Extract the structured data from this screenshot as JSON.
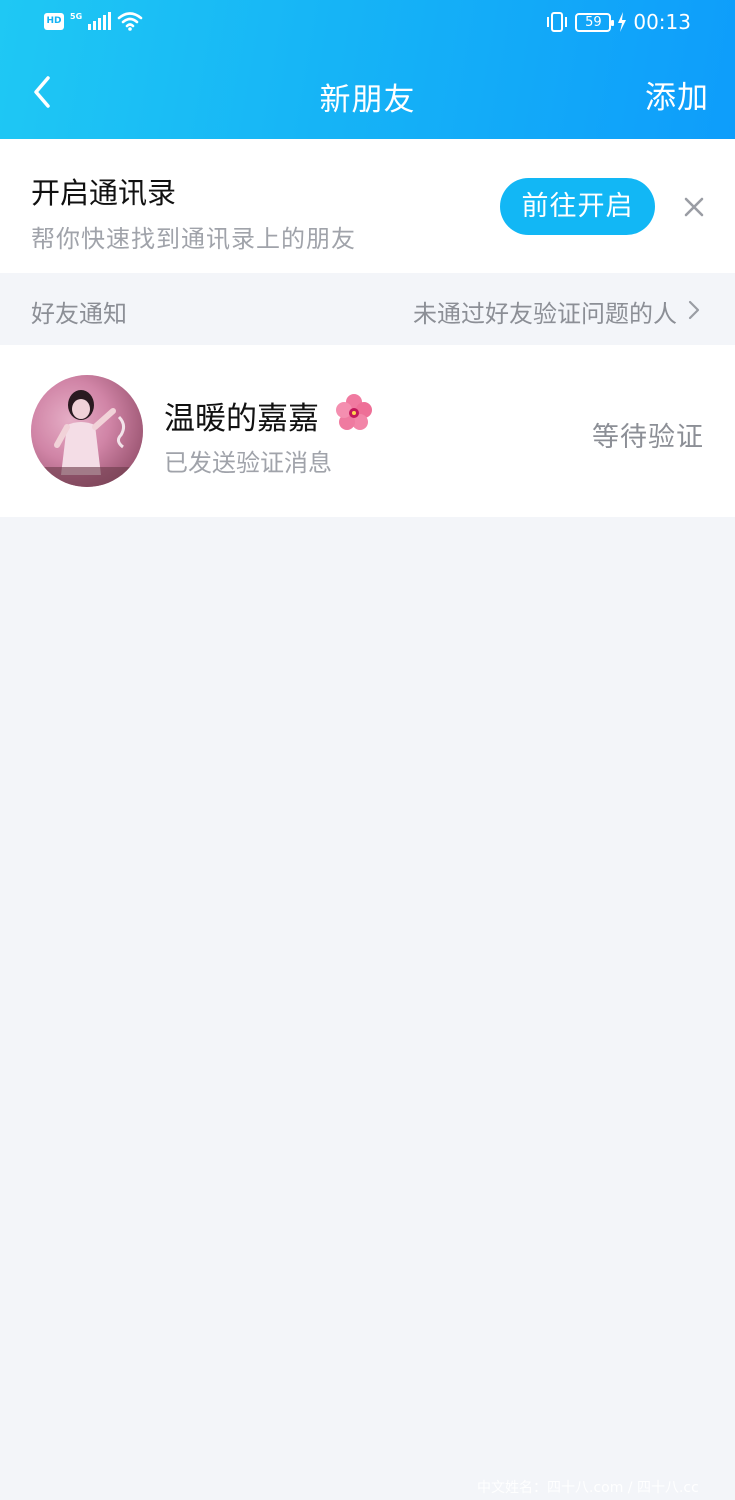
{
  "status_bar": {
    "hd_badge": "HD",
    "network": "5G",
    "battery_level": "59",
    "time": "00:13",
    "icons": [
      "hd-icon",
      "5g-signal-icon",
      "wifi-icon",
      "vibrate-icon",
      "battery-icon",
      "charging-icon"
    ]
  },
  "nav": {
    "title": "新朋友",
    "add_label": "添加",
    "back_icon": "chevron-left-icon"
  },
  "contacts_prompt": {
    "title": "开启通讯录",
    "subtitle": "帮你快速找到通讯录上的朋友",
    "action_label": "前往开启",
    "close_icon": "close-icon"
  },
  "section": {
    "title": "好友通知",
    "link_label": "未通过好友验证问题的人",
    "link_icon": "chevron-right-icon"
  },
  "friend_requests": [
    {
      "name": "温暖的嘉嘉",
      "name_icon": "hibiscus-flower-icon",
      "message": "已发送验证消息",
      "status": "等待验证"
    }
  ],
  "colors": {
    "header_start": "#1fc8f4",
    "header_end": "#0e9dfb",
    "accent_button": "#12b7f5",
    "background": "#f3f5f9"
  },
  "watermark": "中文姓名：四十八.com / 四十八.cc"
}
